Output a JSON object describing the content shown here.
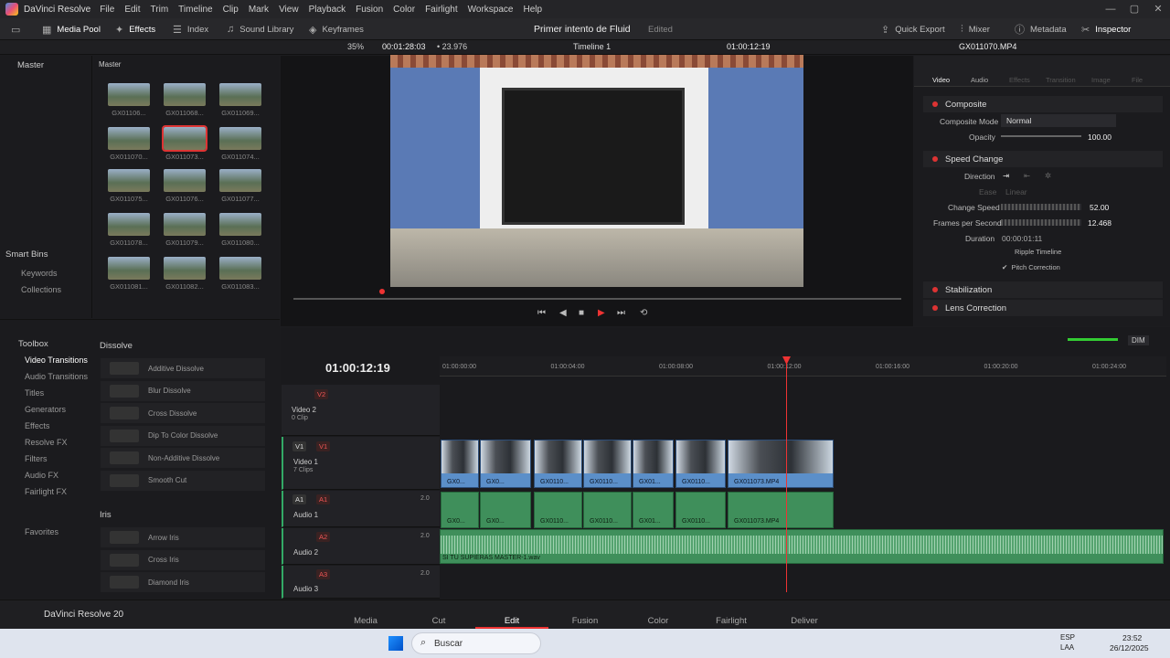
{
  "titlebar": {
    "app": "DaVinci Resolve",
    "menu": [
      "File",
      "Edit",
      "Trim",
      "Timeline",
      "Clip",
      "Mark",
      "View",
      "Playback",
      "Fusion",
      "Color",
      "Fairlight",
      "Workspace",
      "Help"
    ]
  },
  "toolbar": {
    "media_pool": "Media Pool",
    "effects": "Effects",
    "index": "Index",
    "sound_library": "Sound Library",
    "keyframes": "Keyframes",
    "project": "Primer intento de Fluid",
    "edited": "Edited",
    "quick_export": "Quick Export",
    "mixer": "Mixer",
    "metadata": "Metadata",
    "inspector": "Inspector"
  },
  "viewerbar": {
    "zoom": "35%",
    "timecode_left": "00:01:28:03",
    "fps": "23.976",
    "timeline": "Timeline 1",
    "timecode_right": "01:00:12:19",
    "clip_name": "GX011070.MP4"
  },
  "media_pool": {
    "left_header": "Master",
    "right_header": "Master",
    "smart_bins": "Smart Bins",
    "keywords": "Keywords",
    "collections": "Collections",
    "clips": [
      "GX01106...",
      "GX011068...",
      "GX011069...",
      "GX011070...",
      "GX011073...",
      "GX011074...",
      "GX011075...",
      "GX011076...",
      "GX011077...",
      "GX011078...",
      "GX011079...",
      "GX011080...",
      "GX011081...",
      "GX011082...",
      "GX011083..."
    ]
  },
  "effects": {
    "toolbox": "Toolbox",
    "items": [
      "Video Transitions",
      "Audio Transitions",
      "Titles",
      "Generators",
      "Effects",
      "Resolve FX",
      "Filters",
      "Audio FX",
      "Fairlight FX",
      "Favorites"
    ],
    "dissolve_header": "Dissolve",
    "dissolve": [
      "Additive Dissolve",
      "Blur Dissolve",
      "Cross Dissolve",
      "Dip To Color Dissolve",
      "Non-Additive Dissolve",
      "Smooth Cut"
    ],
    "iris_header": "Iris",
    "iris": [
      "Arrow Iris",
      "Cross Iris",
      "Diamond Iris"
    ]
  },
  "inspector": {
    "tabs": [
      "Video",
      "Audio",
      "Effects",
      "Transition",
      "Image",
      "File"
    ],
    "composite": "Composite",
    "composite_mode_label": "Composite Mode",
    "composite_mode": "Normal",
    "opacity_label": "Opacity",
    "opacity": "100.00",
    "speed_change": "Speed Change",
    "direction": "Direction",
    "ease": "Ease",
    "ease_val": "Linear",
    "change_speed_label": "Change Speed",
    "change_speed": "52.00",
    "fps_label": "Frames per Second",
    "fps": "12.468",
    "duration_label": "Duration",
    "duration": "00:00:01:11",
    "ripple": "Ripple Timeline",
    "pitch": "Pitch Correction",
    "stabilization": "Stabilization",
    "lens": "Lens Correction"
  },
  "timeline": {
    "timecode": "01:00:12:19",
    "ticks": [
      "01:00:00:00",
      "01:00:04:00",
      "01:00:08:00",
      "01:00:12:00",
      "01:00:16:00",
      "01:00:20:00",
      "01:00:24:00"
    ],
    "v2": "Video 2",
    "v2_sub": "0 Clip",
    "v1": "Video 1",
    "v1_sub": "7 Clips",
    "a1": "Audio 1",
    "a2": "Audio 2",
    "a3": "Audio 3",
    "badge_v2": "V2",
    "badge_v1": "V1",
    "badge_a1": "A1",
    "badge_a2": "A2",
    "badge_a3": "A3",
    "vol": "2.0",
    "dim": "DIM",
    "clips": [
      "GX0...",
      "GX0...",
      "GX0110...",
      "GX0110...",
      "GX01...",
      "GX0110...",
      "GX011073.MP4"
    ],
    "audio_clip": "SI TU SUPIERAS MASTER-1.wav"
  },
  "pages": {
    "brand": "DaVinci Resolve 20",
    "items": [
      "Media",
      "Cut",
      "Edit",
      "Fusion",
      "Color",
      "Fairlight",
      "Deliver"
    ]
  },
  "taskbar": {
    "search": "Buscar",
    "lang": "ESP",
    "lang2": "LAA",
    "time": "23:52",
    "date": "26/12/2025"
  }
}
